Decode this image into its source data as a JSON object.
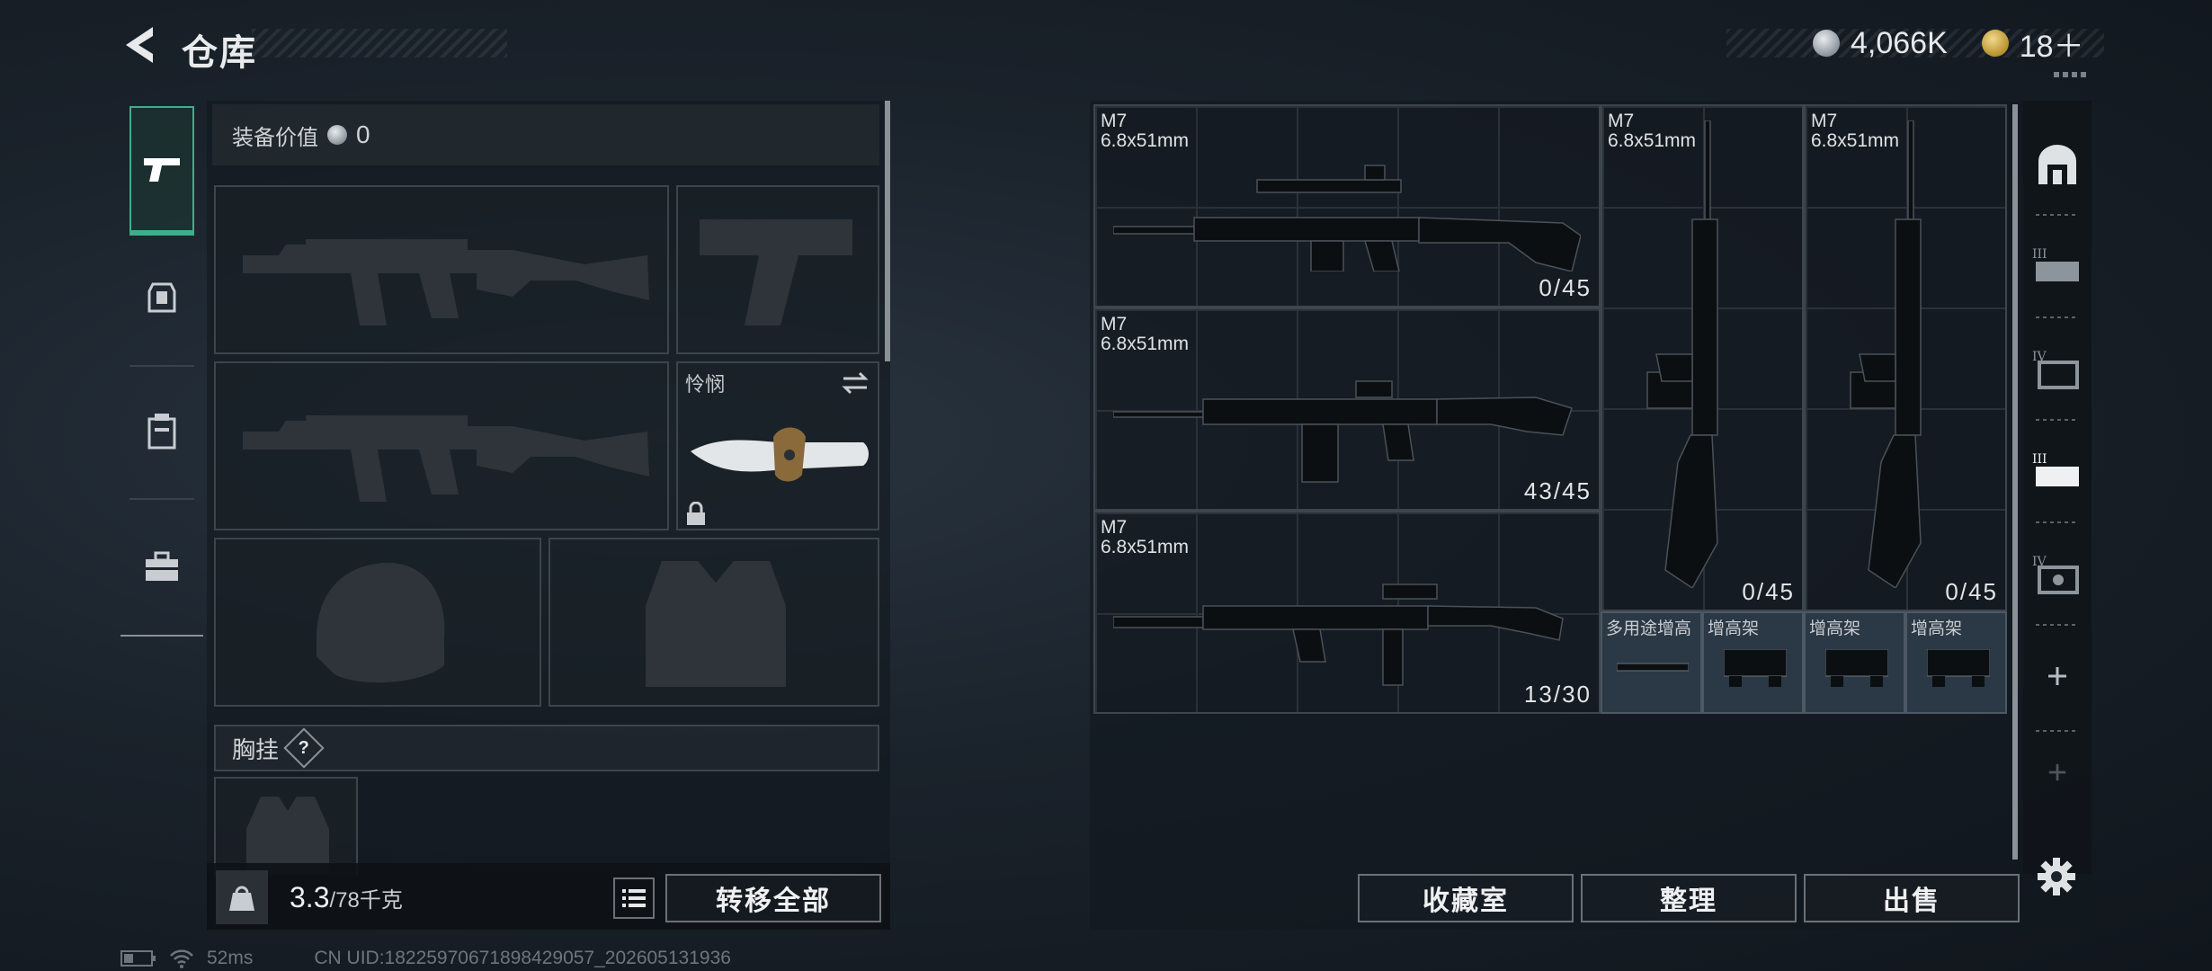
{
  "header": {
    "title": "仓库",
    "money": "4,066K",
    "tokens": "18＋"
  },
  "loadout": {
    "equip_value_label": "装备价值",
    "equip_value": "0",
    "melee_name": "怜悯",
    "chest_rig_label": "胸挂",
    "help_mark": "?",
    "weight_value": "3.3",
    "weight_capacity": "/78千克",
    "transfer_all": "转移全部"
  },
  "storage": {
    "weapons": [
      {
        "name": "M7",
        "caliber": "6.8x51mm",
        "ammo": "0/45"
      },
      {
        "name": "M7",
        "caliber": "6.8x51mm",
        "ammo": "43/45"
      },
      {
        "name": "M7",
        "caliber": "6.8x51mm",
        "ammo": "13/30"
      },
      {
        "name": "M7",
        "caliber": "6.8x51mm",
        "ammo": "0/45"
      },
      {
        "name": "M7",
        "caliber": "6.8x51mm",
        "ammo": "0/45"
      }
    ],
    "attachments": [
      "多用途增高",
      "增高架",
      "增高架",
      "增高架"
    ],
    "buttons": {
      "collection": "收藏室",
      "organize": "整理",
      "sell": "出售"
    }
  },
  "status_bar": {
    "ping": "52ms",
    "uid": "CN UID:18225970671898429057_202605131936"
  },
  "colors": {
    "accent_green": "#3fae8a",
    "attachment_bg": "#2b3845",
    "panel_border": "#3c444c"
  }
}
